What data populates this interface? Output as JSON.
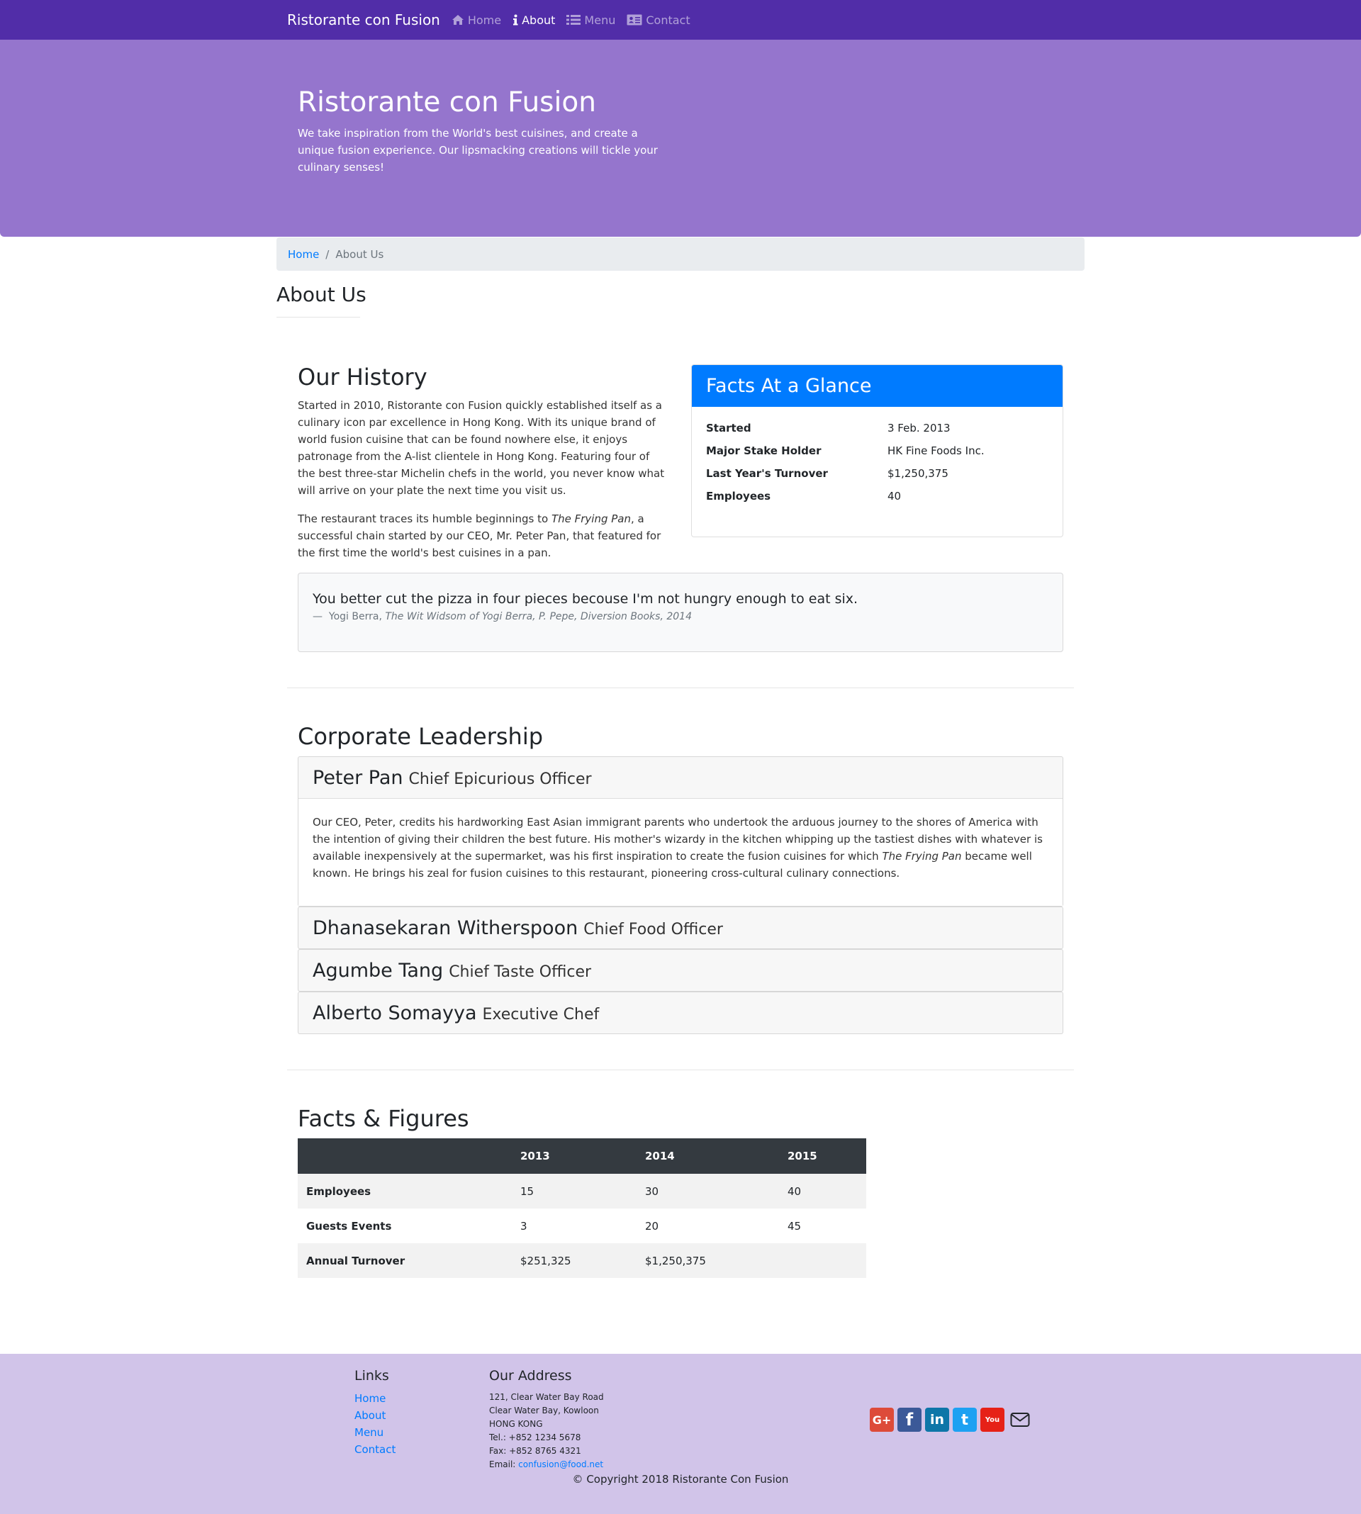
{
  "nav": {
    "brand": "Ristorante con Fusion",
    "links": [
      {
        "label": "Home",
        "icon": "home-icon"
      },
      {
        "label": "About",
        "icon": "info-icon",
        "active": true
      },
      {
        "label": "Menu",
        "icon": "list-icon"
      },
      {
        "label": "Contact",
        "icon": "address-card-icon"
      }
    ]
  },
  "jumbotron": {
    "title": "Ristorante con Fusion",
    "text": "We take inspiration from the World's best cuisines, and create a unique fusion experience. Our lipsmacking creations will tickle your culinary senses!"
  },
  "breadcrumb": {
    "home": "Home",
    "separator": "/",
    "current": "About Us"
  },
  "page_title": "About Us",
  "history": {
    "title": "Our History",
    "p1": "Started in 2010, Ristorante con Fusion quickly established itself as a culinary icon par excellence in Hong Kong. With its unique brand of world fusion cuisine that can be found nowhere else, it enjoys patronage from the A-list clientele in Hong Kong. Featuring four of the best three-star Michelin chefs in the world, you never know what will arrive on your plate the next time you visit us.",
    "p2_before": "The restaurant traces its humble beginnings to ",
    "p2_em": "The Frying Pan",
    "p2_after": ", a successful chain started by our CEO, Mr. Peter Pan, that featured for the first time the world's best cuisines in a pan."
  },
  "facts": {
    "title": "Facts At a Glance",
    "rows": [
      {
        "label": "Started",
        "value": "3 Feb. 2013"
      },
      {
        "label": "Major Stake Holder",
        "value": "HK Fine Foods Inc."
      },
      {
        "label": "Last Year's Turnover",
        "value": "$1,250,375"
      },
      {
        "label": "Employees",
        "value": "40"
      }
    ]
  },
  "quote": {
    "text": "You better cut the pizza in four pieces becouse I'm not hungry enough to eat six.",
    "dash": "—",
    "author": "Yogi Berra,",
    "source": "The Wit Widsom of Yogi Berra, P. Pepe, Diversion Books, 2014"
  },
  "leadership": {
    "title": "Corporate Leadership",
    "leaders": [
      {
        "name": "Peter Pan",
        "role": "Chief Epicurious Officer",
        "bio_before": "Our CEO, Peter, credits his hardworking East Asian immigrant parents who undertook the arduous journey to the shores of America with the intention of giving their children the best future. His mother's wizardy in the kitchen whipping up the tastiest dishes with whatever is available inexpensively at the supermarket, was his first inspiration to create the fusion cuisines for which ",
        "bio_em": "The Frying Pan",
        "bio_after": " became well known. He brings his zeal for fusion cuisines to this restaurant, pioneering cross-cultural culinary connections."
      },
      {
        "name": "Dhanasekaran Witherspoon",
        "role": "Chief Food Officer"
      },
      {
        "name": "Agumbe Tang",
        "role": "Chief Taste Officer"
      },
      {
        "name": "Alberto Somayya",
        "role": "Executive Chef"
      }
    ]
  },
  "figures": {
    "title": "Facts & Figures",
    "headers": [
      "",
      "2013",
      "2014",
      "2015"
    ],
    "rows": [
      {
        "label": "Employees",
        "values": [
          "15",
          "30",
          "40"
        ]
      },
      {
        "label": "Guests Events",
        "values": [
          "3",
          "20",
          "45"
        ]
      },
      {
        "label": "Annual Turnover",
        "values": [
          "$251,325",
          "$1,250,375",
          ""
        ]
      }
    ]
  },
  "footer": {
    "links_title": "Links",
    "links": [
      "Home",
      "About",
      "Menu",
      "Contact"
    ],
    "address_title": "Our Address",
    "address_lines": [
      "121, Clear Water Bay Road",
      "Clear Water Bay, Kowloon",
      "HONG KONG",
      "Tel.: +852 1234 5678",
      "Fax: +852 8765 4321"
    ],
    "email_label": "Email: ",
    "email": "confusion@food.net",
    "social": [
      {
        "icon": "google-plus-icon",
        "glyph": "G+",
        "color": "#dd4b39"
      },
      {
        "icon": "facebook-icon",
        "glyph": "f",
        "color": "#3b5998"
      },
      {
        "icon": "linkedin-icon",
        "glyph": "in",
        "color": "#0e76a8"
      },
      {
        "icon": "twitter-icon",
        "glyph": "t",
        "color": "#1da1f2"
      },
      {
        "icon": "youtube-icon",
        "glyph": "You",
        "color": "#e62117"
      }
    ],
    "copyright": "© Copyright 2018 Ristorante Con Fusion"
  }
}
